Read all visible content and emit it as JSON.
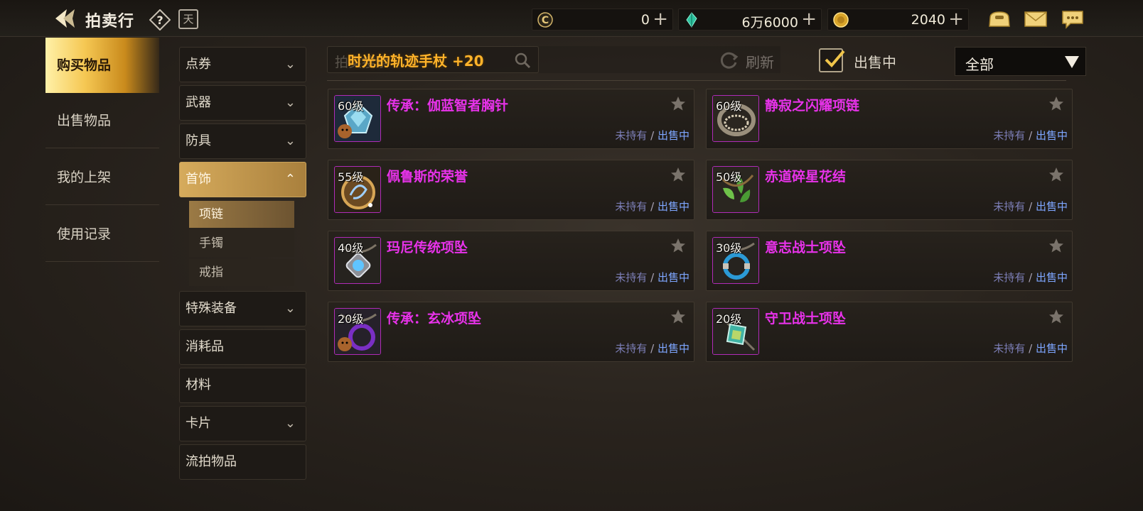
{
  "header": {
    "title": "拍卖行",
    "currencies": [
      {
        "icon": "c-coin-icon",
        "value": "0"
      },
      {
        "icon": "crystal-icon",
        "value": "6万6000"
      },
      {
        "icon": "gold-coin-icon",
        "value": "2040"
      }
    ],
    "plus": "+"
  },
  "sidebar": {
    "tabs": [
      "购买物品",
      "出售物品",
      "我的上架",
      "使用记录"
    ]
  },
  "categories": {
    "items": [
      {
        "label": "点券",
        "chev": "⌄"
      },
      {
        "label": "武器",
        "chev": "⌄"
      },
      {
        "label": "防具",
        "chev": "⌄"
      },
      {
        "label": "首饰",
        "chev": "⌃"
      },
      {
        "label": "特殊装备",
        "chev": "⌄"
      },
      {
        "label": "消耗品",
        "chev": ""
      },
      {
        "label": "材料",
        "chev": ""
      },
      {
        "label": "卡片",
        "chev": "⌄"
      },
      {
        "label": "流拍物品",
        "chev": ""
      }
    ],
    "subitems": [
      "项链",
      "手镯",
      "戒指"
    ]
  },
  "search": {
    "placeholder": "拍卖搜索",
    "value": "时光的轨迹手杖 +20",
    "refresh_label": "刷新",
    "on_sale_label": "出售中",
    "filter_value": "全部"
  },
  "items": [
    {
      "level": "60级",
      "name": "传承：伽蓝智者胸针"
    },
    {
      "level": "60级",
      "name": "静寂之闪耀项链"
    },
    {
      "level": "55级",
      "name": "佩鲁斯的荣誉"
    },
    {
      "level": "50级",
      "name": "赤道碎星花结"
    },
    {
      "level": "40级",
      "name": "玛尼传统项坠"
    },
    {
      "level": "30级",
      "name": "意志战士项坠"
    },
    {
      "level": "20级",
      "name": "传承：玄冰项坠"
    },
    {
      "level": "20级",
      "name": "守卫战士项坠"
    }
  ],
  "item_status": {
    "owned": "未持有",
    "separator": "/",
    "selling": "出售中"
  },
  "colors": {
    "accent_gold": "#f5c752",
    "item_name": "#e832ea",
    "search_text": "#ffb32a",
    "status_selling": "#7ea6ff"
  }
}
